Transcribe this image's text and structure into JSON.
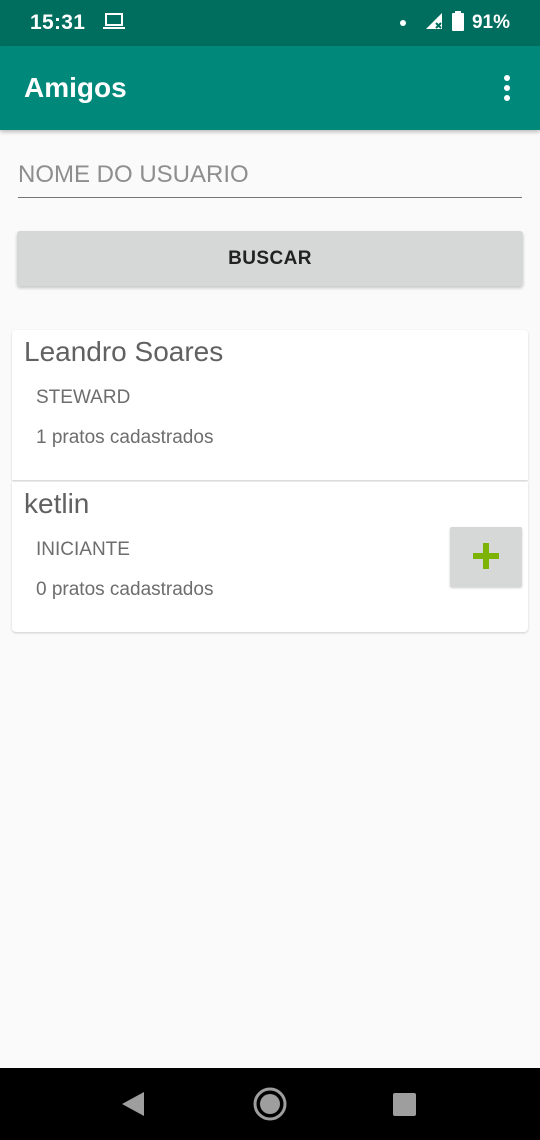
{
  "status_bar": {
    "time": "15:31",
    "battery": "91%",
    "icons": [
      "laptop-icon",
      "notification-dot-icon",
      "signal-icon",
      "battery-icon"
    ]
  },
  "app_bar": {
    "title": "Amigos",
    "menu_icon": "overflow-menu-icon"
  },
  "search": {
    "placeholder": "NOME DO USUARIO",
    "value": "",
    "button_label": "BUSCAR"
  },
  "friends": [
    {
      "name": "Leandro Soares",
      "level": "STEWARD",
      "dishes": "1 pratos cadastrados",
      "has_add_button": false
    },
    {
      "name": "ketlin",
      "level": "INICIANTE",
      "dishes": "0 pratos cadastrados",
      "has_add_button": true
    }
  ],
  "colors": {
    "status_bar": "#006e5f",
    "app_bar": "#00897b",
    "add_icon": "#7cb305"
  },
  "nav_bar": {
    "icons": [
      "back-icon",
      "home-icon",
      "recents-icon"
    ]
  }
}
